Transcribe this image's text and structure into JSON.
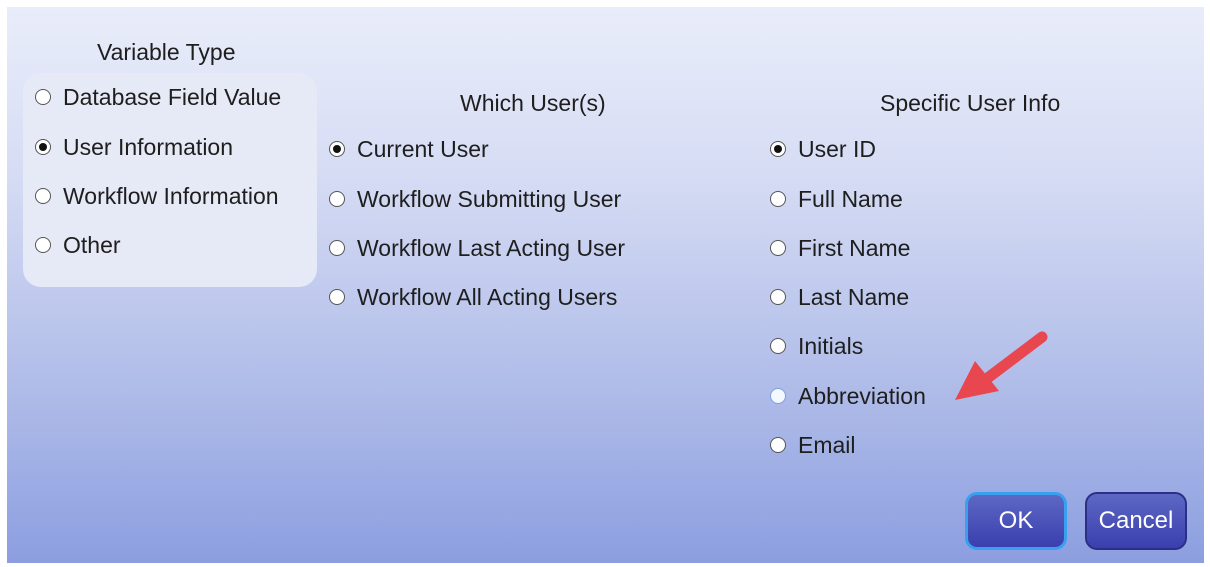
{
  "headings": {
    "variable_type": "Variable Type",
    "which_users": "Which User(s)",
    "specific_user_info": "Specific User Info"
  },
  "variable_type_options": [
    "Database Field Value",
    "User Information",
    "Workflow Information",
    "Other"
  ],
  "variable_type_selected": "User Information",
  "which_users_options": [
    "Current User",
    "Workflow Submitting User",
    "Workflow Last Acting User",
    "Workflow All Acting Users"
  ],
  "which_users_selected": "Current User",
  "user_info_options": [
    "User ID",
    "Full Name",
    "First Name",
    "Last Name",
    "Initials",
    "Abbreviation",
    "Email"
  ],
  "user_info_selected": "User ID",
  "user_info_hovered": "Abbreviation",
  "buttons": {
    "ok": "OK",
    "cancel": "Cancel"
  },
  "colors": {
    "annotation_arrow": "#e8474f",
    "button_fill": "#3f46b3",
    "focus_border": "#39a0f0"
  }
}
